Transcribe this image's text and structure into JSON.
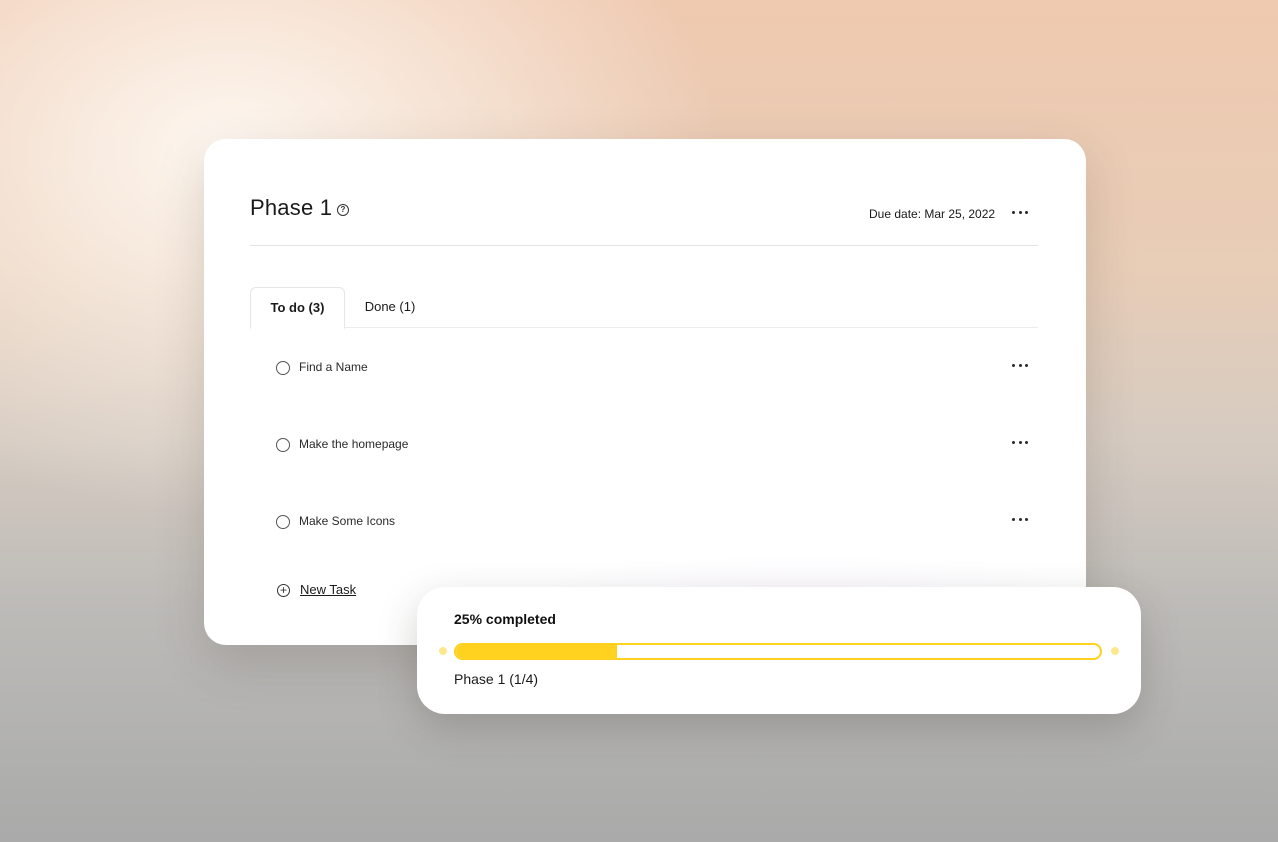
{
  "header": {
    "title": "Phase 1",
    "help_icon": "help-circle-icon",
    "due_date": "Due date: Mar 25, 2022",
    "menu_icon": "more-horizontal-icon"
  },
  "tabs": [
    {
      "label": "To do (3)",
      "active": true
    },
    {
      "label": "Done (1)",
      "active": false
    }
  ],
  "tasks": [
    {
      "label": "Find a Name"
    },
    {
      "label": "Make the homepage"
    },
    {
      "label": "Make Some Icons"
    }
  ],
  "new_task": {
    "label": "New Task",
    "icon": "plus-circle-icon"
  },
  "progress": {
    "title": "25% completed",
    "value": 0.25,
    "subtitle": "Phase 1 (1/4)",
    "color": "#ffd21f"
  }
}
